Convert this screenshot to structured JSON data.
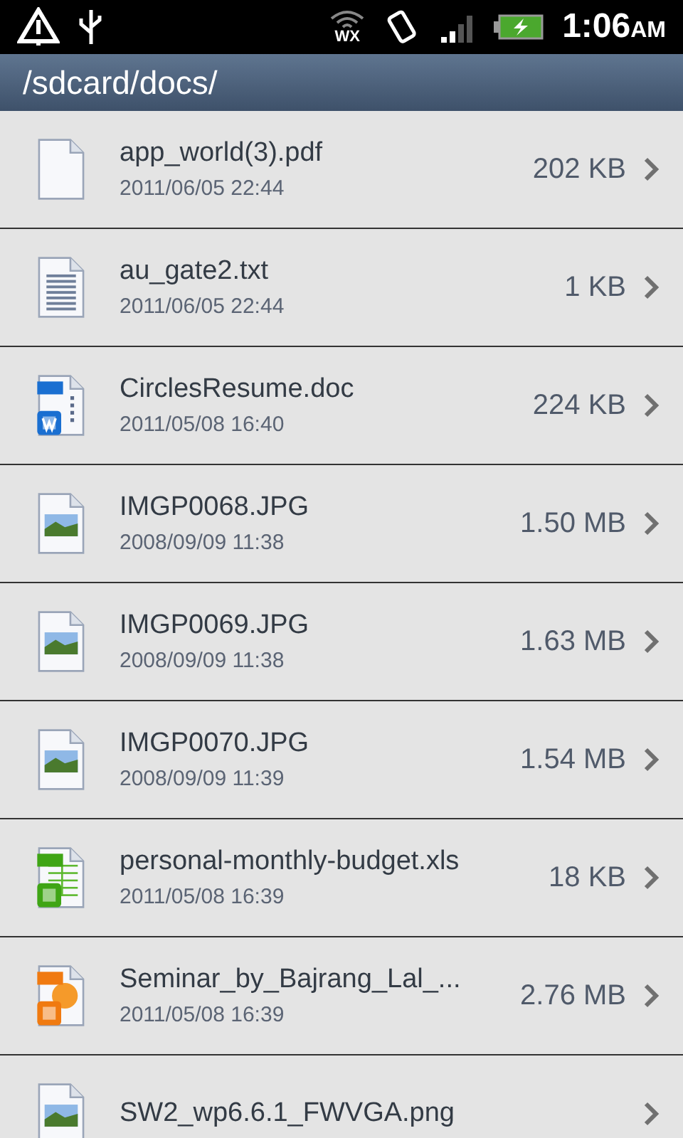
{
  "status_bar": {
    "wifi_label": "WX",
    "time": "1:06",
    "ampm": "AM"
  },
  "title_bar": {
    "path": "/sdcard/docs/"
  },
  "files": [
    {
      "kind": "blank",
      "name": "app_world(3).pdf",
      "date": "2011/06/05 22:44",
      "size": "202 KB"
    },
    {
      "kind": "text",
      "name": "au_gate2.txt",
      "date": "2011/06/05 22:44",
      "size": "1 KB"
    },
    {
      "kind": "word",
      "name": "CirclesResume.doc",
      "date": "2011/05/08 16:40",
      "size": "224 KB"
    },
    {
      "kind": "image",
      "name": "IMGP0068.JPG",
      "date": "2008/09/09 11:38",
      "size": "1.50 MB"
    },
    {
      "kind": "image",
      "name": "IMGP0069.JPG",
      "date": "2008/09/09 11:38",
      "size": "1.63 MB"
    },
    {
      "kind": "image",
      "name": "IMGP0070.JPG",
      "date": "2008/09/09 11:39",
      "size": "1.54 MB"
    },
    {
      "kind": "sheet",
      "name": "personal-monthly-budget.xls",
      "date": "2011/05/08 16:39",
      "size": "18 KB"
    },
    {
      "kind": "slides",
      "name": "Seminar_by_Bajrang_Lal_...",
      "date": "2011/05/08 16:39",
      "size": "2.76 MB"
    },
    {
      "kind": "png",
      "name": "SW2_wp6.6.1_FWVGA.png"
    }
  ]
}
